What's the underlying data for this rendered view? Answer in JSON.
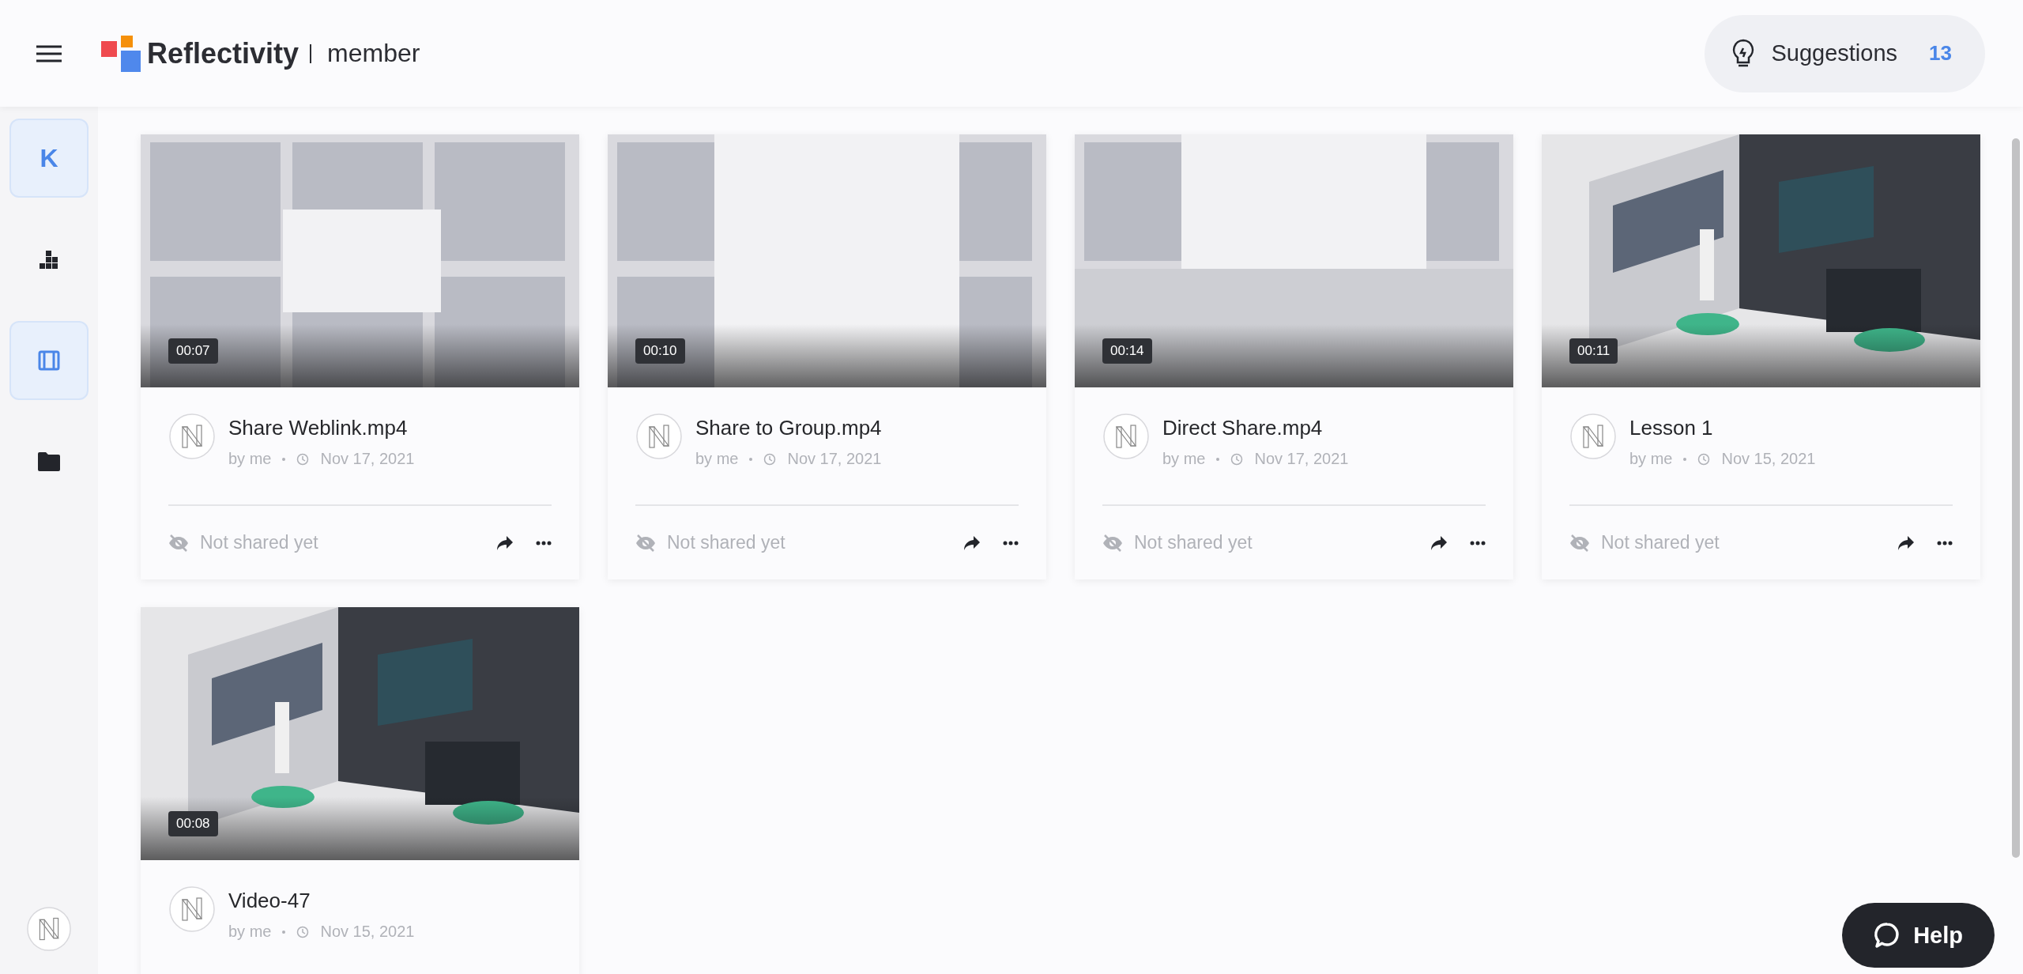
{
  "header": {
    "brand": "Reflectivity",
    "role": "member",
    "suggestions": {
      "label": "Suggestions",
      "count": "13"
    }
  },
  "sidebar": {
    "workspace": {
      "initial": "K",
      "selected": true
    },
    "items": [
      {
        "kind": "chart",
        "selected": false
      },
      {
        "kind": "film",
        "selected": true
      },
      {
        "kind": "folder",
        "selected": false
      }
    ]
  },
  "videos": [
    {
      "title": "Share Weblink.mp4",
      "author": "by me",
      "date": "Nov 17, 2021",
      "duration": "00:07",
      "status": "Not shared yet"
    },
    {
      "title": "Share to Group.mp4",
      "author": "by me",
      "date": "Nov 17, 2021",
      "duration": "00:10",
      "status": "Not shared yet"
    },
    {
      "title": "Direct Share.mp4",
      "author": "by me",
      "date": "Nov 17, 2021",
      "duration": "00:14",
      "status": "Not shared yet"
    },
    {
      "title": "Lesson 1",
      "author": "by me",
      "date": "Nov 15, 2021",
      "duration": "00:11",
      "status": "Not shared yet"
    },
    {
      "title": "Video-47",
      "author": "by me",
      "date": "Nov 15, 2021",
      "duration": "00:08"
    }
  ],
  "help": {
    "label": "Help"
  }
}
